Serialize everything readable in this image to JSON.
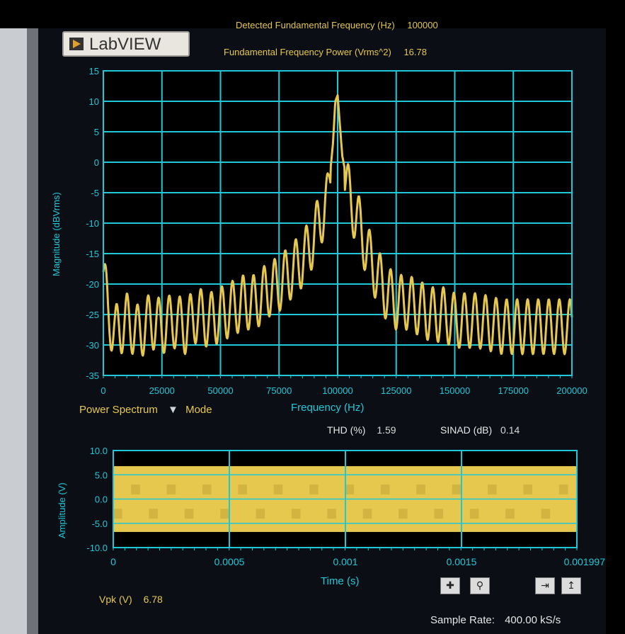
{
  "app": {
    "logo_text": "LabVIEW"
  },
  "header": {
    "partial_label": "Detected Fundamental Frequency (Hz)",
    "partial_value": "100000",
    "power_label": "Fundamental Frequency Power (Vrms^2)",
    "power_value": "16.78"
  },
  "spectrum_controls": {
    "mode_label": "Power Spectrum",
    "mode_caption": "Mode"
  },
  "measurements": {
    "thd_label": "THD (%)",
    "thd_value": "1.59",
    "sinad_label": "SINAD (dB)",
    "sinad_value": "0.14",
    "vpk_label": "Vpk (V)",
    "vpk_value": "6.78",
    "sample_rate_label": "Sample Rate:",
    "sample_rate_value": "400.00 kS/s"
  },
  "colors": {
    "grid": "#1ec8d8",
    "trace": "#e6c84e",
    "panel": "#0b0f15",
    "plot_bg": "#000000"
  },
  "icons": [
    "cursor-crosshair-icon",
    "zoom-icon",
    "autoscale-x-icon",
    "autoscale-y-icon",
    "triangle-down-icon"
  ],
  "chart_data": [
    {
      "type": "line",
      "title": "",
      "xlabel": "Frequency (Hz)",
      "ylabel": "Magnitude (dBVrms)",
      "xlim": [
        0,
        200000
      ],
      "ylim": [
        -35,
        15
      ],
      "grid": true,
      "x_ticks": [
        "0",
        "25000",
        "50000",
        "75000",
        "100000",
        "125000",
        "150000",
        "175000",
        "200000"
      ],
      "y_ticks": [
        "15",
        "10",
        "5",
        "0",
        "-5",
        "-10",
        "-15",
        "-20",
        "-25",
        "-30",
        "-35"
      ],
      "series": [
        {
          "x": [
            0,
            2000,
            5000,
            10000,
            15000,
            20000,
            25000,
            30000,
            35000,
            40000,
            45000,
            50000,
            55000,
            60000,
            65000,
            70000,
            75000,
            80000,
            85000,
            88000,
            90000,
            92000,
            94000,
            96000,
            98000,
            99000,
            100000,
            101000,
            102000,
            104000,
            106000,
            108000,
            110000,
            112000,
            115000,
            120000,
            125000,
            130000,
            135000,
            140000,
            145000,
            150000,
            155000,
            160000,
            170000,
            180000,
            190000,
            200000
          ],
          "values": [
            -17,
            -24,
            -27,
            -25,
            -27,
            -25,
            -26,
            -25,
            -26,
            -24,
            -25,
            -24,
            -23,
            -22,
            -22,
            -20,
            -19,
            -17,
            -15,
            -13,
            -11,
            -9,
            -7,
            -5,
            3,
            10,
            11,
            6,
            1,
            -3,
            -6,
            -8,
            -10,
            -13,
            -16,
            -20,
            -22,
            -22,
            -23,
            -24,
            -24,
            -25,
            -25,
            -25,
            -26,
            -26,
            -26,
            -26
          ]
        }
      ]
    },
    {
      "type": "area",
      "title": "",
      "xlabel": "Time (s)",
      "ylabel": "Amplitude (V)",
      "xlim": [
        0,
        0.001997
      ],
      "ylim": [
        -10,
        10
      ],
      "grid": true,
      "x_ticks": [
        "0",
        "0.0005",
        "0.001",
        "0.0015",
        "0.001997"
      ],
      "y_ticks": [
        "10.0",
        "5.0",
        "0.0",
        "-5.0",
        "-10.0"
      ],
      "series": [
        {
          "upper": 6.78,
          "lower": -6.78
        }
      ]
    }
  ]
}
